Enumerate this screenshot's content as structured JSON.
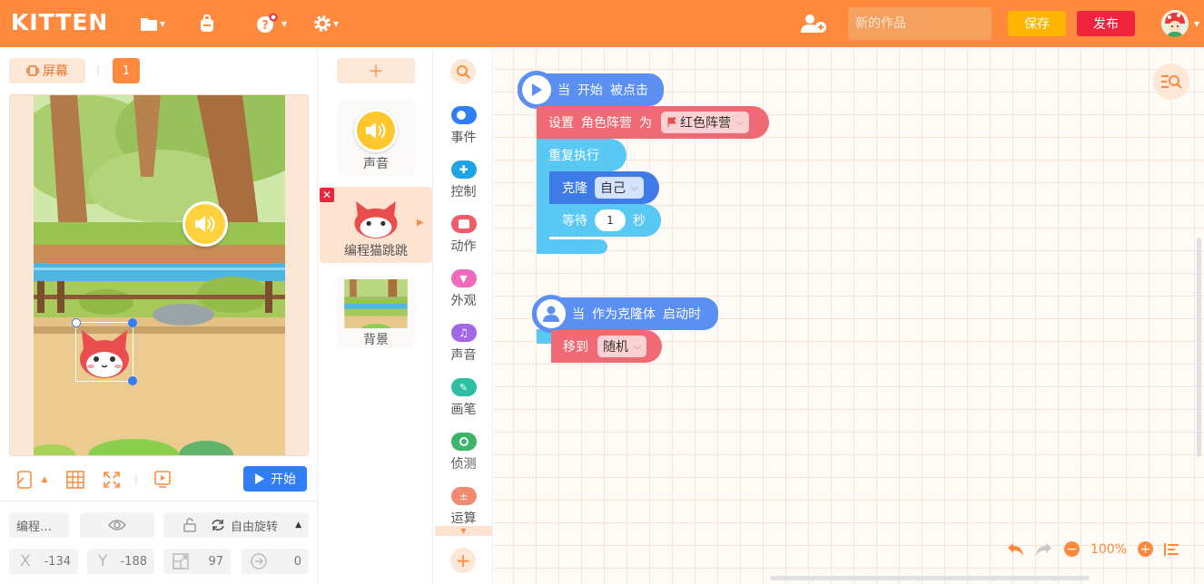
{
  "app": {
    "logo": "KITTEN"
  },
  "header": {
    "title_placeholder": "新的作品",
    "save_label": "保存",
    "publish_label": "发布"
  },
  "stage": {
    "screen_label": "屏幕",
    "screen_number": "1",
    "start_label": "开始"
  },
  "sprite_props": {
    "name": "编程…",
    "rotation_mode": "自由旋转",
    "x_label": "X",
    "x": "-134",
    "y_label": "Y",
    "y": "-188",
    "size": "97",
    "direction": "0"
  },
  "sprites": [
    {
      "name": "声音"
    },
    {
      "name": "编程猫跳跳"
    },
    {
      "name": "背景"
    }
  ],
  "categories": [
    {
      "label": "事件",
      "color": "#2f7df7"
    },
    {
      "label": "控制",
      "color": "#1ea3e6"
    },
    {
      "label": "动作",
      "color": "#ef5b6a"
    },
    {
      "label": "外观",
      "color": "#f06ab9"
    },
    {
      "label": "声音",
      "color": "#a366e8"
    },
    {
      "label": "画笔",
      "color": "#2ebfa2"
    },
    {
      "label": "侦测",
      "color": "#3cb56a"
    },
    {
      "label": "运算",
      "color": "#f08b72"
    }
  ],
  "blocks": {
    "start_when": "当",
    "start_event": "开始",
    "start_clicked": "被点击",
    "set_label": "设置",
    "set_var": "角色阵营",
    "set_as": "为",
    "set_value": "红色阵营",
    "repeat_label": "重复执行",
    "clone_label": "克隆",
    "clone_target": "自己",
    "wait_label": "等待",
    "wait_value": "1",
    "wait_unit": "秒",
    "clone_when": "当",
    "clone_event": "作为克隆体",
    "clone_start": "启动时",
    "move_label": "移到",
    "move_target": "随机"
  },
  "workspace": {
    "zoom": "100%"
  },
  "colors": {
    "accent": "#ff8a3d",
    "publish": "#f0253d",
    "save": "#ffb400",
    "start": "#2f7df7"
  }
}
